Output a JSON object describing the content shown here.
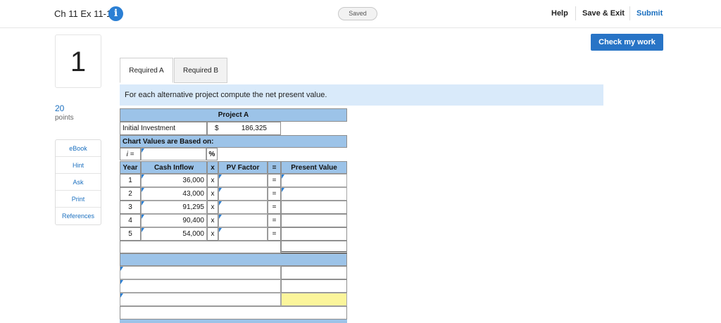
{
  "header": {
    "assignment_title": "Ch 11 Ex 11-10",
    "info_icon": "info-icon",
    "saved_status": "Saved",
    "help": "Help",
    "save_exit": "Save & Exit",
    "submit": "Submit"
  },
  "check_button": "Check my work",
  "question": {
    "number": "1",
    "points_value": "20",
    "points_label": "points"
  },
  "sidebar": {
    "items": [
      "eBook",
      "Hint",
      "Ask",
      "Print",
      "References"
    ]
  },
  "tabs": [
    "Required A",
    "Required B"
  ],
  "instruction": "For each alternative project compute the net present value.",
  "worksheet": {
    "project_title": "Project A",
    "initial_investment_label": "Initial Investment",
    "currency_symbol": "$",
    "initial_investment_value": "186,325",
    "chart_values_label": "Chart Values are Based on:",
    "rate_label": "i =",
    "percent_sign": "%",
    "columns": {
      "year": "Year",
      "cash_inflow": "Cash Inflow",
      "times": "x",
      "pv_factor": "PV Factor",
      "equals": "=",
      "present_value": "Present Value"
    },
    "rows": [
      {
        "year": "1",
        "cash_inflow": "36,000",
        "x": "x",
        "eq": "="
      },
      {
        "year": "2",
        "cash_inflow": "43,000",
        "x": "x",
        "eq": "="
      },
      {
        "year": "3",
        "cash_inflow": "91,295",
        "x": "x",
        "eq": "="
      },
      {
        "year": "4",
        "cash_inflow": "90,400",
        "x": "x",
        "eq": "="
      },
      {
        "year": "5",
        "cash_inflow": "54,000",
        "x": "x",
        "eq": "="
      }
    ]
  },
  "colors": {
    "accent_blue": "#2874c6",
    "header_fill": "#9cc3e8",
    "instruction_fill": "#d9eafa",
    "highlight_yellow": "#fbf59b"
  }
}
